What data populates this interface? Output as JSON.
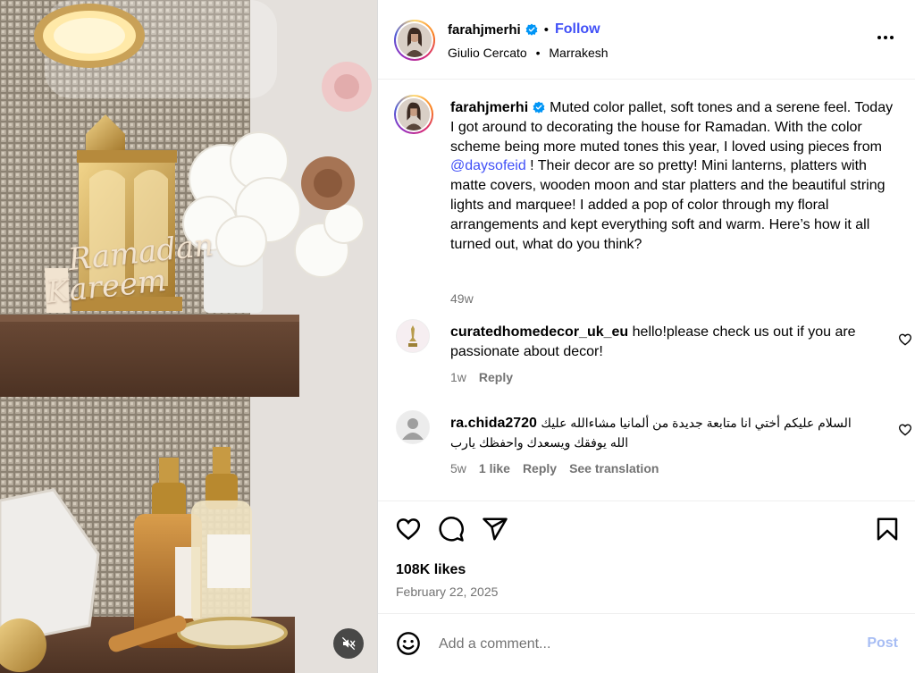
{
  "post": {
    "author": "farahjmerhi",
    "follow_label": "Follow",
    "separator": "•",
    "audio_label": "Giulio Cercato",
    "location": "Marrakesh",
    "media_text_line1": "Ramadan",
    "media_text_line2": "Kareem",
    "caption": {
      "username": "farahjmerhi",
      "text_before": "Muted color pallet, soft tones and a serene feel. Today I got around to decorating the house for Ramadan. With the color scheme being more muted tones this year, I loved using pieces from ",
      "mention": "@daysofeid",
      "text_after": " ! Their decor are so pretty! Mini lanterns, platters with matte covers, wooden moon and star platters and the beautiful string lights and marquee! I added a pop of color through my floral arrangements and kept everything soft and warm. Here’s how it all turned out, what do you think?",
      "age": "49w"
    },
    "comments": [
      {
        "username": "curatedhomedecor_uk_eu",
        "text": "hello!please check us out if you are passionate about decor!",
        "age": "1w",
        "reply_label": "Reply"
      },
      {
        "username": "ra.chida2720",
        "text": "السلام عليكم أختي انا متابعة جديدة من ألمانيا مشاءالله عليك الله يوفقك ويسعدك واحفظك يارب",
        "age": "5w",
        "likes_label": "1 like",
        "reply_label": "Reply",
        "translate_label": "See translation"
      }
    ],
    "likes": "108K likes",
    "date": "February 22, 2025",
    "add_comment_placeholder": "Add a comment...",
    "post_label": "Post"
  },
  "colors": {
    "link": "#4150f7",
    "muted": "#737373",
    "post_disabled": "#a7bdf4"
  },
  "icons": [
    "verified-badge-icon",
    "more-options-icon",
    "heart-icon",
    "comment-icon",
    "share-icon",
    "bookmark-icon",
    "emoji-icon",
    "mute-icon"
  ]
}
